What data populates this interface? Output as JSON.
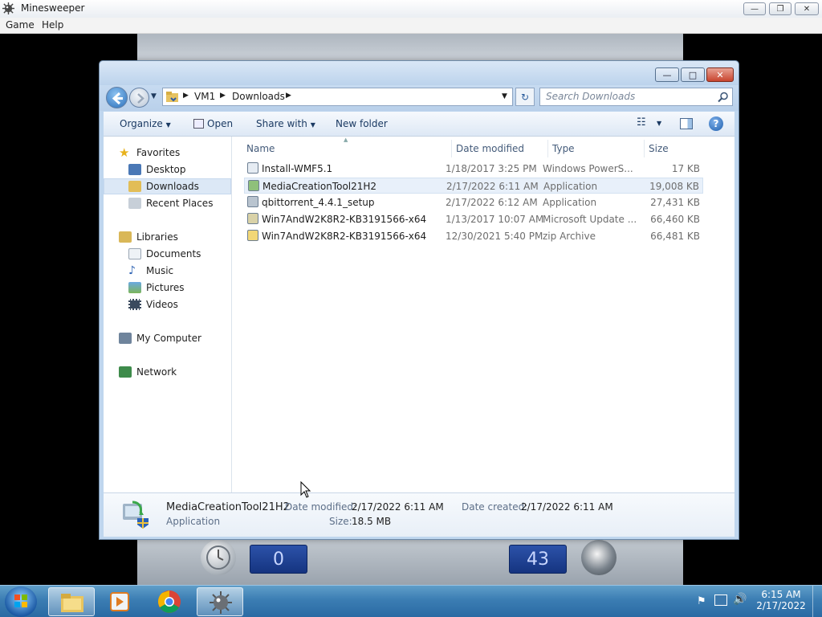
{
  "minesweeper": {
    "title": "Minesweeper",
    "menu": [
      "Game",
      "Help"
    ],
    "time_counter": "0",
    "mine_counter": "43"
  },
  "explorer": {
    "breadcrumb": [
      "VM1",
      "Downloads"
    ],
    "search_placeholder": "Search Downloads",
    "commands": {
      "organize": "Organize",
      "open": "Open",
      "share_with": "Share with",
      "new_folder": "New folder"
    },
    "nav": {
      "favorites": "Favorites",
      "favorites_items": [
        "Desktop",
        "Downloads",
        "Recent Places"
      ],
      "libraries": "Libraries",
      "libraries_items": [
        "Documents",
        "Music",
        "Pictures",
        "Videos"
      ],
      "my_computer": "My Computer",
      "network": "Network"
    },
    "columns": {
      "name": "Name",
      "date": "Date modified",
      "type": "Type",
      "size": "Size"
    },
    "files": [
      {
        "name": "Install-WMF5.1",
        "date": "1/18/2017 3:25 PM",
        "type": "Windows PowerS...",
        "size": "17 KB",
        "icon": "powershell-script-icon"
      },
      {
        "name": "MediaCreationTool21H2",
        "date": "2/17/2022 6:11 AM",
        "type": "Application",
        "size": "19,008 KB",
        "icon": "media-creation-tool-icon"
      },
      {
        "name": "qbittorrent_4.4.1_setup",
        "date": "2/17/2022 6:12 AM",
        "type": "Application",
        "size": "27,431 KB",
        "icon": "installer-icon"
      },
      {
        "name": "Win7AndW2K8R2-KB3191566-x64",
        "date": "1/13/2017 10:07 AM",
        "type": "Microsoft Update ...",
        "size": "66,460 KB",
        "icon": "update-package-icon"
      },
      {
        "name": "Win7AndW2K8R2-KB3191566-x64",
        "date": "12/30/2021 5:40 PM",
        "type": "zip Archive",
        "size": "66,481 KB",
        "icon": "zip-archive-icon"
      }
    ],
    "details": {
      "name": "MediaCreationTool21H2",
      "type": "Application",
      "date_modified_label": "Date modified:",
      "date_modified": "2/17/2022 6:11 AM",
      "date_created_label": "Date created:",
      "date_created": "2/17/2022 6:11 AM",
      "size_label": "Size:",
      "size": "18.5 MB"
    }
  },
  "taskbar": {
    "time": "6:15 AM",
    "date": "2/17/2022",
    "accent": "#3b7db3"
  }
}
